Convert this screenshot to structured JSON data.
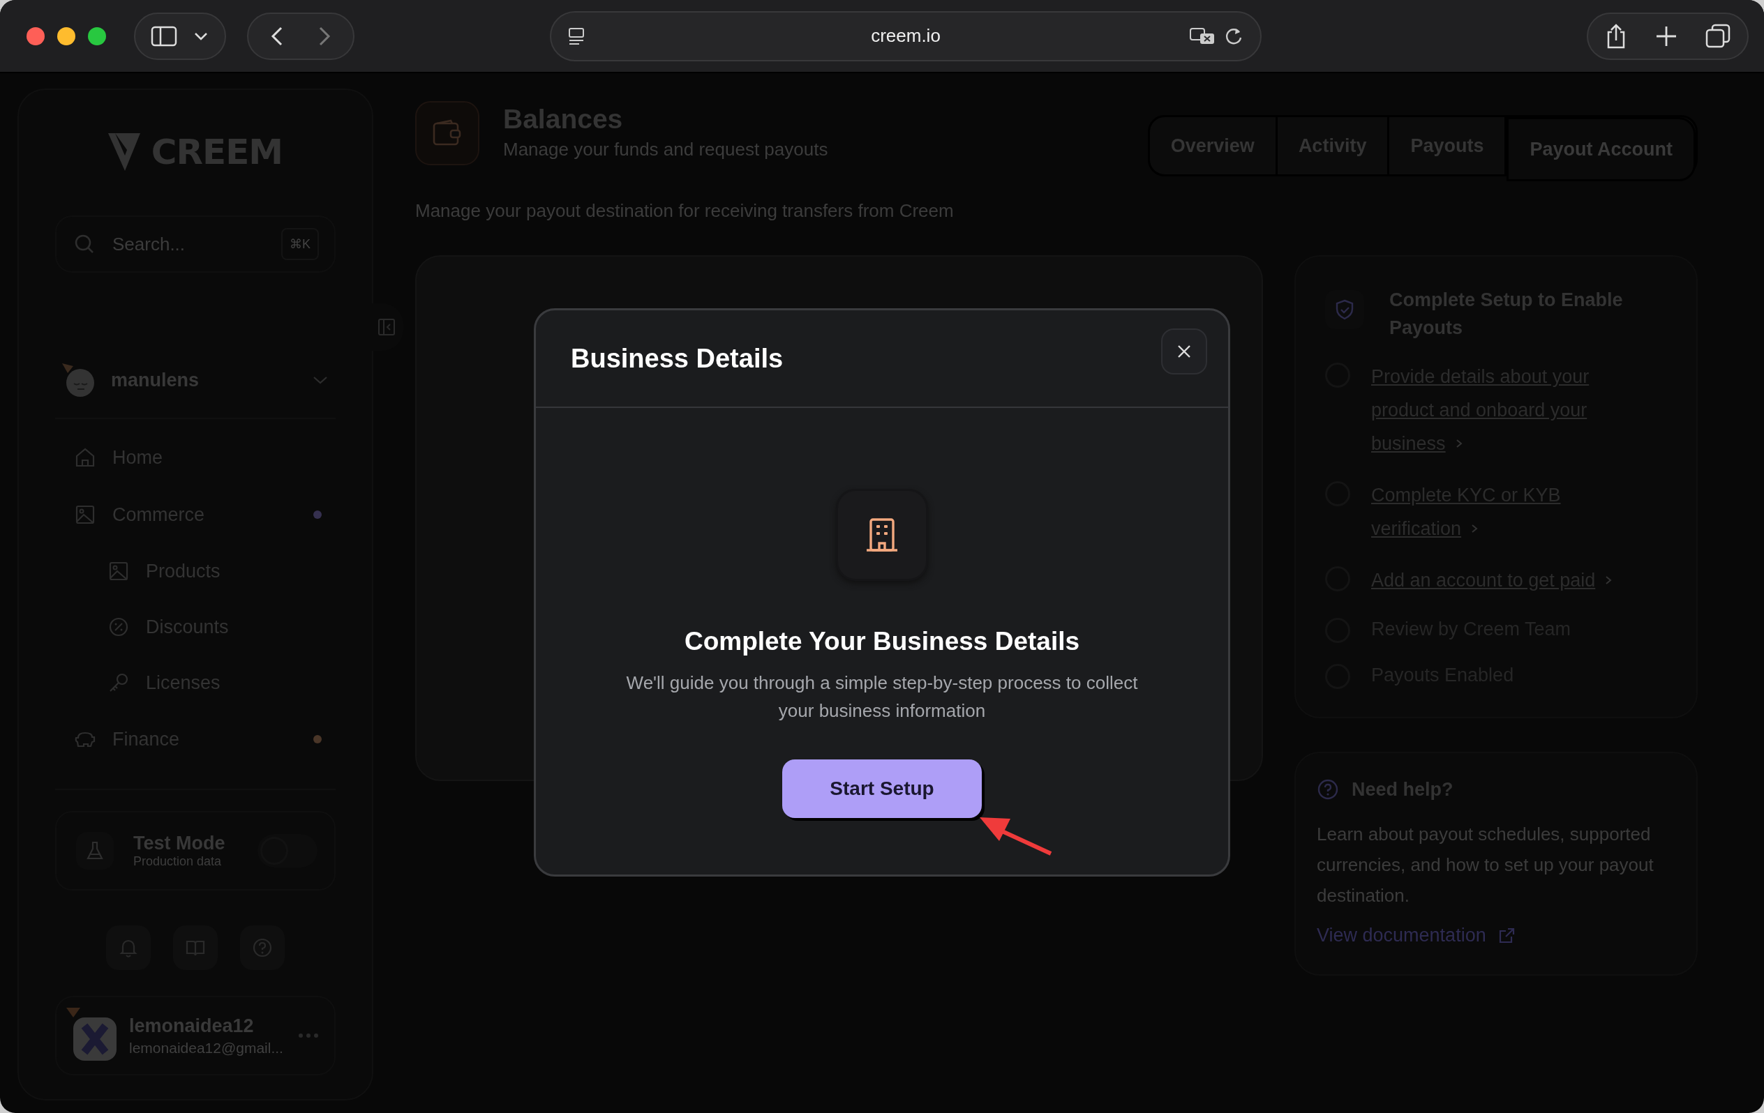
{
  "browser": {
    "url": "creem.io"
  },
  "sidebar": {
    "logo": "CREEM",
    "search": {
      "placeholder": "Search...",
      "shortcut": "⌘K"
    },
    "workspace": {
      "name": "manulens"
    },
    "nav": [
      {
        "label": "Home"
      },
      {
        "label": "Commerce",
        "color": "#35304f",
        "children": [
          {
            "label": "Products"
          },
          {
            "label": "Discounts"
          },
          {
            "label": "Licenses"
          }
        ]
      },
      {
        "label": "Finance",
        "color": "#4a3628"
      }
    ],
    "test_mode": {
      "title": "Test Mode",
      "subtitle": "Production data",
      "on": false
    },
    "user": {
      "name": "lemonaidea12",
      "email": "lemonaidea12@gmail..."
    }
  },
  "header": {
    "title": "Balances",
    "subtitle": "Manage your funds and request payouts",
    "tabs": [
      {
        "label": "Overview",
        "selected": false
      },
      {
        "label": "Activity",
        "selected": false
      },
      {
        "label": "Payouts",
        "selected": false
      },
      {
        "label": "Payout Account",
        "selected": true
      }
    ]
  },
  "description": "Manage your payout destination for receiving transfers from Creem",
  "setup_card": {
    "title": "Complete Setup to Enable Payouts",
    "steps": [
      {
        "label": "Provide details about your product and onboard your business",
        "kind": "link",
        "checked": false
      },
      {
        "label": "Complete KYC or KYB verification",
        "kind": "link",
        "checked": false
      },
      {
        "label": "Add an account to get paid",
        "kind": "link",
        "checked": false
      },
      {
        "label": "Review by Creem Team",
        "kind": "text",
        "checked": false
      },
      {
        "label": "Payouts Enabled",
        "kind": "text",
        "checked": false
      }
    ]
  },
  "help_card": {
    "title": "Need help?",
    "text": "Learn about payout schedules, supported currencies, and how to set up your payout destination.",
    "link": "View documentation"
  },
  "modal": {
    "title": "Business Details",
    "heading": "Complete Your Business Details",
    "text": "We'll guide you through a simple step-by-step process to collect your business information",
    "button": "Start Setup"
  }
}
